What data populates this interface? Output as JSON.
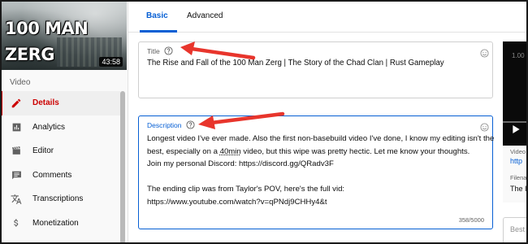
{
  "sidebar": {
    "thumbnail_title": "100 MAN ZERG",
    "thumbnail_duration": "43:58",
    "section_label": "Video",
    "items": [
      {
        "label": "Details",
        "icon": "pencil-icon",
        "active": true
      },
      {
        "label": "Analytics",
        "icon": "bar-chart-icon",
        "active": false
      },
      {
        "label": "Editor",
        "icon": "film-clapper-icon",
        "active": false
      },
      {
        "label": "Comments",
        "icon": "comment-icon",
        "active": false
      },
      {
        "label": "Transcriptions",
        "icon": "translate-icon",
        "active": false
      },
      {
        "label": "Monetization",
        "icon": "dollar-icon",
        "active": false
      }
    ]
  },
  "tabs": [
    {
      "label": "Basic",
      "active": true
    },
    {
      "label": "Advanced",
      "active": false
    }
  ],
  "title_field": {
    "label": "Title",
    "value": "The Rise and Fall of the 100 Man Zerg | The Story of the Chad Clan | Rust Gameplay"
  },
  "description_field": {
    "label": "Description",
    "lines": [
      {
        "before": "Longest video I've ever made. Also the first non-basebuild video I've done, I know my editing isn't the",
        "underlined": "",
        "after": ""
      },
      {
        "before": "best, especially on a ",
        "underlined": "40min",
        "after": " video, but this wipe was pretty hectic. Let me know your thoughts."
      },
      {
        "before": "Join my personal Discord: https://discord.gg/QRadv3F",
        "underlined": "",
        "after": ""
      },
      {
        "before": "",
        "underlined": "",
        "after": ""
      },
      {
        "before": "The ending clip was from Taylor's POV, here's the full vid:",
        "underlined": "",
        "after": ""
      },
      {
        "before": "https://www.youtube.com/watch?v=qPNdj9CHHy4&t",
        "underlined": "",
        "after": ""
      }
    ],
    "char_count": "358/5000"
  },
  "preview": {
    "time_partial": "1.00",
    "video_label_partial": "Video",
    "video_link_partial": "http",
    "filename_label_partial": "Filena",
    "filename_partial": "The I",
    "lower_box_partial": "Best"
  },
  "colors": {
    "accent_blue": "#065fd4",
    "active_red": "#cc0000",
    "arrow_red": "#e8352c"
  }
}
